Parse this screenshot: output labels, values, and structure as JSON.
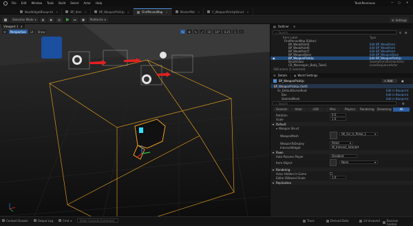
{
  "window": {
    "menu": [
      "File",
      "Edit",
      "Window",
      "Tools",
      "Build",
      "Select",
      "Actor",
      "Help"
    ],
    "title_right": "TeamRevenous"
  },
  "tabs": [
    {
      "label": "NewWidgetBlueprint"
    },
    {
      "label": "BP_Item"
    },
    {
      "label": "BP_WeaponPickUp"
    },
    {
      "label": "FirstPersonMap",
      "active": true
    },
    {
      "label": "MasterMat"
    },
    {
      "label": "F_WeaponPickUpStruct"
    }
  ],
  "toolbar": {
    "selection_mode": "Selection Mode",
    "platforms": "Platforms",
    "settings": "Settings"
  },
  "viewport": {
    "tab": "Viewport 1",
    "perspective": "Perspective",
    "lit": "Lit",
    "show": "Show",
    "grid_step": "10",
    "rot_step": "10°",
    "scale_step": "0.25",
    "speed": "1"
  },
  "outliner": {
    "title": "Outliner",
    "search_placeholder": "Search...",
    "col_label": "Item Label",
    "col_type": "Type",
    "items": [
      {
        "label": "FirstPersonMap (Editor)",
        "type": ""
      },
      {
        "label": "BP_WeakPoint4",
        "type": "Edit BP_WeakPoint"
      },
      {
        "label": "BP_WeakPoint6",
        "type": "Edit BP_WeakPoint"
      },
      {
        "label": "BP_WeakPoint7",
        "type": "Edit BP_WeakPoint"
      },
      {
        "label": "BP_WeaponBase",
        "type": "Edit BP_WeaponBase"
      },
      {
        "label": "BP_WeaponPickUp",
        "type": "Edit BP_WeaponPickUp",
        "selected": true
      },
      {
        "label": "BrushGlass",
        "type": "GeometryCollectionActor"
      },
      {
        "label": "CR_Mannequin_Body_Tube1",
        "type": "LevelSequenceActor"
      }
    ],
    "footer": "168 actors (1 selected)"
  },
  "details": {
    "title": "Details",
    "world_settings": "World Settings",
    "actor_name": "BP_WeaponPickUp",
    "add_label": "+ Add",
    "components": [
      {
        "label": "BP_WeaponPickUp (Self)"
      },
      {
        "label": "Ac_DefaultSceneRoot",
        "link": "Edit in Blueprint"
      },
      {
        "label": "Box",
        "link": "Edit in Blueprint"
      },
      {
        "label": "SkeletalMesh",
        "link": "Edit in Blueprint"
      }
    ],
    "search_placeholder": "Search",
    "filters": [
      "General",
      "Actor",
      "LOD",
      "Misc",
      "Physics",
      "Rendering",
      "Streaming",
      "All"
    ],
    "transform": [
      {
        "label": "Rotation",
        "value": "0.0"
      },
      {
        "label": "Scale",
        "value": "1.0"
      }
    ],
    "default_cat": "Default",
    "weapon_struct": "Weapon Struct",
    "weapon_mesh_label": "WeaponMesh",
    "weapon_mesh_value": "SK_Ssr_Ic_Pistol_1",
    "weapon_display_label": "WeaponToDisplay",
    "weapon_display_value": "Pistol",
    "interact_label": "InteractWidget",
    "interact_value": "W_Interact_Interact",
    "pawn_cat": "Pawn",
    "auto_possess_label": "Auto Possess Player",
    "auto_possess_value": "Disabled",
    "item_object_label": "Item Object",
    "item_object_value": "None",
    "rendering_cat": "Rendering",
    "hidden_label": "Actor Hidden In Game",
    "billboard_label": "Editor Billboard Scale",
    "billboard_value": "1.0",
    "replication_cat": "Replication"
  },
  "status": {
    "content_drawer": "Content Drawer",
    "output_log": "Output Log",
    "cmd": "Cmd",
    "cmd_placeholder": "Enter Console Command",
    "trace": "Trace",
    "derived_data": "Derived Data",
    "unsaved": "14 Unsaved",
    "revision": "Revision Control"
  },
  "colors": {
    "accent": "#2c5fa3",
    "select_outline": "#e8a020",
    "highlight": "#214a7a"
  }
}
